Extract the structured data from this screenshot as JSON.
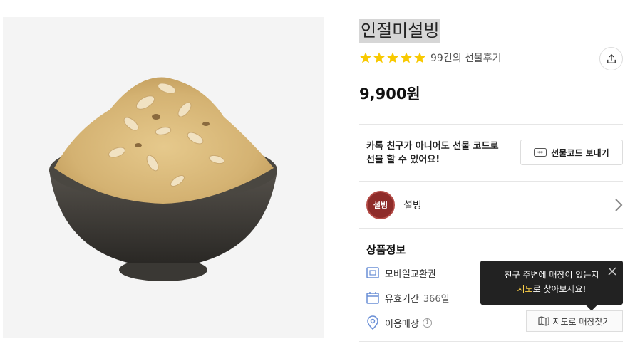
{
  "product": {
    "title": "인절미설빙",
    "rating": 5,
    "review_text": "99건의 선물후기",
    "price": "9,900원",
    "image_icon": "bingsu-bowl-image"
  },
  "gift_code": {
    "text_line1": "카톡 친구가 아니어도 선물 코드로",
    "text_line2": "선물 할 수 있어요!",
    "button_label": "선물코드 보내기"
  },
  "brand": {
    "name": "설빙",
    "logo_text": "설빙"
  },
  "info": {
    "section_title": "상품정보",
    "type_label": "모바일교환권",
    "validity_label": "유효기간",
    "validity_value": "366일",
    "store_label": "이용매장"
  },
  "tooltip": {
    "line1": "친구 주변에 매장이 있는지",
    "highlight": "지도",
    "line2_rest": "로 찾아보세요!"
  },
  "map_button": {
    "label": "지도로 매장찾기"
  },
  "colors": {
    "star": "#f8c900",
    "brand": "#8e2c2a",
    "tooltip_bg": "#222222",
    "highlight": "#ffd24a"
  }
}
